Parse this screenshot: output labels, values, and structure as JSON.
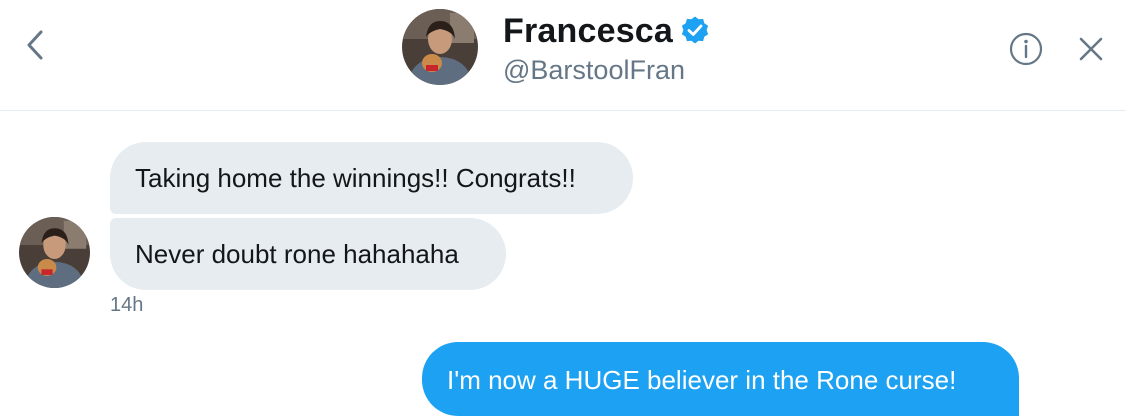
{
  "header": {
    "name": "Francesca",
    "handle": "@BarstoolFran",
    "verified": true
  },
  "messages": [
    {
      "direction": "incoming",
      "text": "Taking home the winnings!! Congrats!!"
    },
    {
      "direction": "incoming",
      "text": "Never doubt rone hahahaha"
    },
    {
      "direction": "outgoing",
      "text": "I'm now a HUGE believer in the Rone curse!"
    }
  ],
  "timestamp": "14h",
  "colors": {
    "accent": "#1da1f2",
    "incoming_bubble": "#e6ecf0",
    "secondary_text": "#657786",
    "icon": "#657786"
  },
  "icons": {
    "back": "chevron-left-icon",
    "verified": "verified-badge-icon",
    "info": "info-icon",
    "close": "close-icon"
  }
}
